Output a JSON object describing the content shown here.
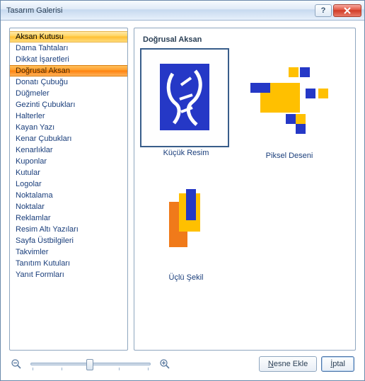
{
  "window": {
    "title": "Tasarım Galerisi"
  },
  "sidebar": {
    "items": [
      {
        "label": "Aksan Kutusu",
        "state": "selected"
      },
      {
        "label": "Dama Tahtaları",
        "state": ""
      },
      {
        "label": "Dikkat İşaretleri",
        "state": ""
      },
      {
        "label": "Doğrusal Aksan",
        "state": "active"
      },
      {
        "label": "Donatı Çubuğu",
        "state": ""
      },
      {
        "label": "Düğmeler",
        "state": ""
      },
      {
        "label": "Gezinti Çubukları",
        "state": ""
      },
      {
        "label": "Halterler",
        "state": ""
      },
      {
        "label": "Kayan Yazı",
        "state": ""
      },
      {
        "label": "Kenar Çubukları",
        "state": ""
      },
      {
        "label": "Kenarlıklar",
        "state": ""
      },
      {
        "label": "Kuponlar",
        "state": ""
      },
      {
        "label": "Kutular",
        "state": ""
      },
      {
        "label": "Logolar",
        "state": ""
      },
      {
        "label": "Noktalama",
        "state": ""
      },
      {
        "label": "Noktalar",
        "state": ""
      },
      {
        "label": "Reklamlar",
        "state": ""
      },
      {
        "label": "Resim Altı Yazıları",
        "state": ""
      },
      {
        "label": "Sayfa Üstbilgileri",
        "state": ""
      },
      {
        "label": "Takvimler",
        "state": ""
      },
      {
        "label": "Tanıtım Kutuları",
        "state": ""
      },
      {
        "label": "Yanıt Formları",
        "state": ""
      }
    ]
  },
  "gallery": {
    "heading": "Doğrusal Aksan",
    "items": [
      {
        "label": "Küçük Resim",
        "selected": true,
        "kind": "kucuk"
      },
      {
        "label": "Piksel Deseni",
        "selected": false,
        "kind": "piksel"
      },
      {
        "label": "Üçlü Şekil",
        "selected": false,
        "kind": "uclu"
      }
    ]
  },
  "buttons": {
    "insert": "Nesne Ekle",
    "cancel": "İptal"
  },
  "icons": {
    "help": "?",
    "zoom_out": "zoom-out-icon",
    "zoom_in": "zoom-in-icon"
  }
}
